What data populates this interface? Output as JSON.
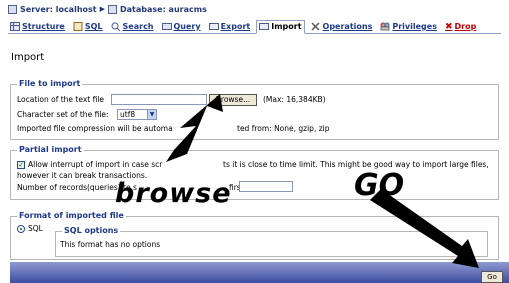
{
  "breadcrumb": {
    "server": "Server: localhost",
    "database": "Database: auracms"
  },
  "tabs": [
    {
      "label": "Structure"
    },
    {
      "label": "SQL"
    },
    {
      "label": "Search"
    },
    {
      "label": "Query"
    },
    {
      "label": "Export"
    },
    {
      "label": "Import"
    },
    {
      "label": "Operations"
    },
    {
      "label": "Privileges"
    },
    {
      "label": "Drop"
    }
  ],
  "page_title": "Import",
  "file_to_import": {
    "legend": "File to import",
    "location_label": "Location of the text file",
    "browse_label": "Browse...",
    "max_size": "(Max: 16,384KB)",
    "charset_label": "Character set of the file:",
    "charset_value": "utf8",
    "compression_text_left": "Imported file compression will be automa",
    "compression_text_right": "ted from: None, gzip, zip"
  },
  "partial_import": {
    "legend": "Partial import",
    "allow_interrupt_left": "Allow interrupt of import in case scr",
    "allow_interrupt_right": "ts it is close to time limit. This might be good way to import large files,",
    "allow_interrupt_line2": "however it can break transactions.",
    "records_label": "Number of records(queries) to s",
    "records_label_tail": "first:"
  },
  "format": {
    "legend": "Format of imported file",
    "sql_radio_label": "SQL",
    "sql_options_legend": "SQL options",
    "sql_options_text": "This format has no options"
  },
  "go_button": "Go",
  "annotations": {
    "browse": "browse",
    "go": "GO"
  },
  "colors": {
    "link_blue": "#1d3a8c",
    "drop_red": "#c00000",
    "bar_gradient_top": "#8e9ad0",
    "bar_gradient_bottom": "#3d4ca0"
  },
  "icons": [
    "server-icon",
    "database-icon",
    "structure-icon",
    "sql-icon",
    "search-icon",
    "query-icon",
    "export-icon",
    "import-icon",
    "operations-icon",
    "privileges-icon",
    "drop-icon"
  ]
}
